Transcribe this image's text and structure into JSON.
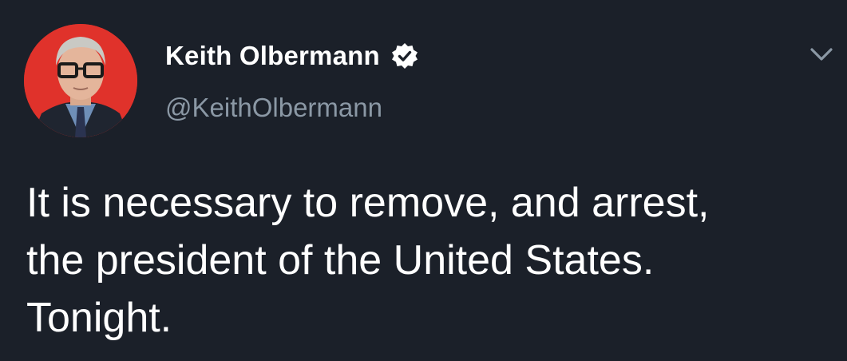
{
  "tweet": {
    "author": {
      "display_name": "Keith Olbermann",
      "handle": "@KeithOlbermann",
      "verified": true,
      "avatar": "profile-photo"
    },
    "menu_icon": "chevron-down-icon",
    "text": "It is necessary to remove, and arrest,\nthe president of the United States.\nTonight."
  },
  "colors": {
    "background": "#1b2029",
    "text": "#ffffff",
    "handle": "#8b98a5",
    "avatar_background": "#e0322b"
  }
}
